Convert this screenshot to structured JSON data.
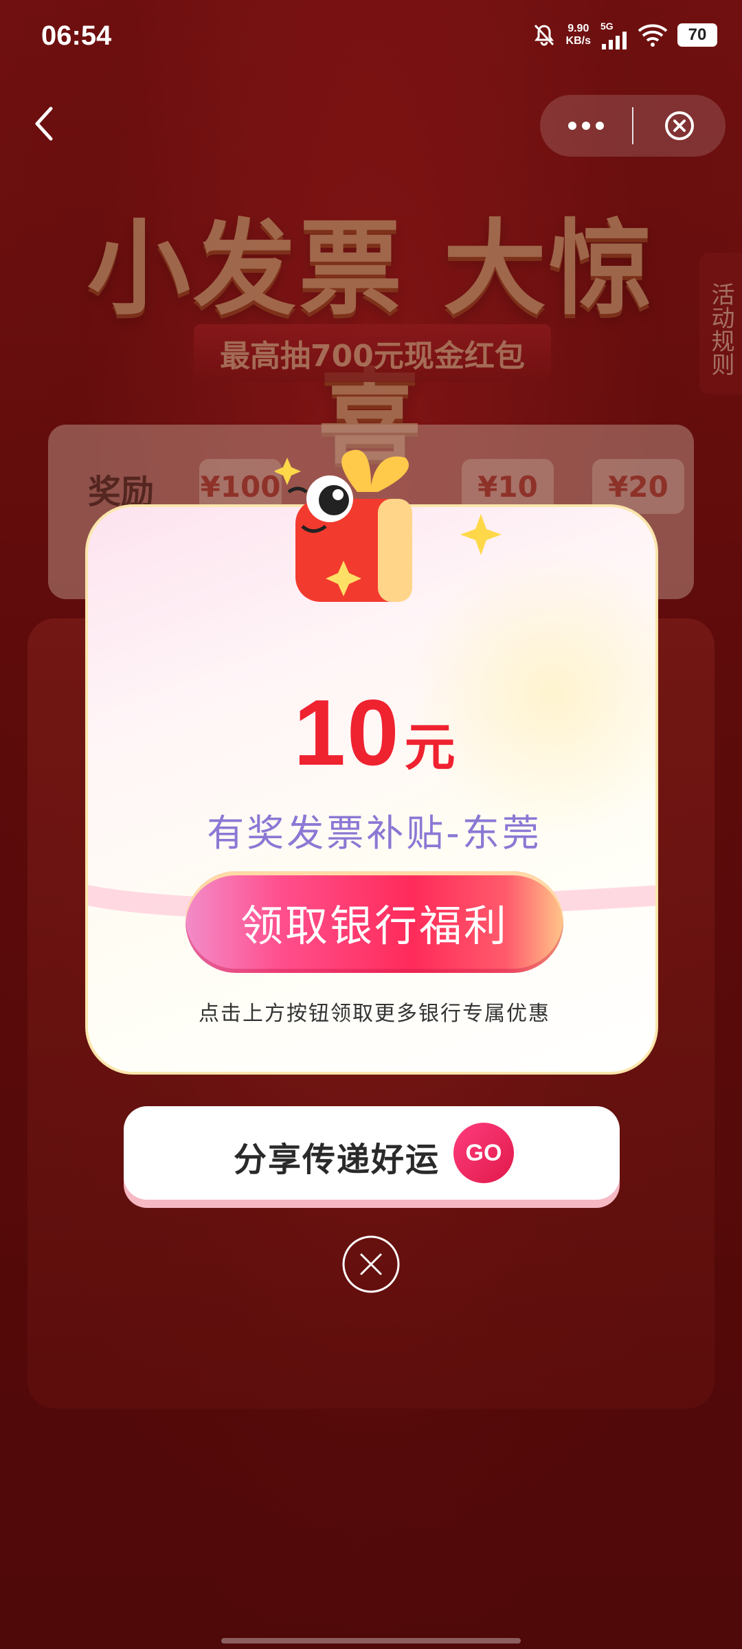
{
  "status_bar": {
    "time": "06:54",
    "net_speed_value": "9.90",
    "net_speed_unit": "KB/s",
    "network": "5G",
    "battery": "70"
  },
  "nav": {
    "back_icon": "chevron-left-icon",
    "more_icon": "more-dots-icon",
    "close_icon": "close-circle-icon"
  },
  "background": {
    "title": "小发票 大惊喜",
    "subtitle": "最高抽700元现金红包",
    "rules_tab": "活动规则",
    "reward_label": "奖励",
    "reward_chips": [
      "¥100",
      "¥10",
      "¥20"
    ]
  },
  "popup": {
    "amount": "10",
    "unit": "元",
    "subsidy_name": "有奖发票补贴-东莞",
    "claim_button": "领取银行福利",
    "hint": "点击上方按钮领取更多银行专属优惠"
  },
  "share": {
    "label": "分享传递好运",
    "go_button": "GO"
  },
  "colors": {
    "accent_red": "#ef2230",
    "subsidy_purple": "#8a78d4",
    "button_pink": "#ff2b5a"
  }
}
